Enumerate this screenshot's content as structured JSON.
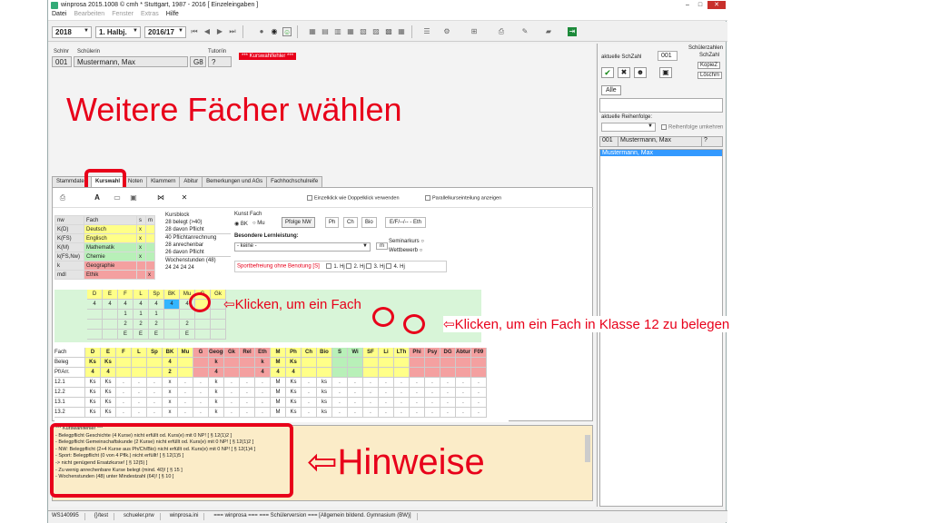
{
  "window": {
    "title": "winprosa 2015.1008 © cmh * Stuttgart, 1987 - 2016 [ Einzeleingaben ]"
  },
  "menu": [
    {
      "label": "Datei",
      "enabled": true
    },
    {
      "label": "Bearbeiten",
      "enabled": false
    },
    {
      "label": "Fenster",
      "enabled": false
    },
    {
      "label": "Extras",
      "enabled": false
    },
    {
      "label": "Hilfe",
      "enabled": true
    }
  ],
  "toolbar": {
    "year": "2018",
    "halbjahr": "1. Halbj.",
    "schuljahr": "2016/17"
  },
  "student": {
    "label_nr": "Schlnr",
    "label_name": "Schülerin",
    "label_tutor": "Tutor/in",
    "nr": "001",
    "name": "Mustermann, Max",
    "class": "G8",
    "tutor": "?",
    "error_flag": "*** Kurswahlfehler ***"
  },
  "overlay": {
    "title": "Weitere Fächer wählen",
    "callout1": "Klicken, um ein Fach",
    "callout2": "Klicken, um ein Fach in Klasse 12 zu belegen",
    "hints": "Hinweise"
  },
  "tabs": [
    "Stammdaten",
    "Kurswahl",
    "Noten",
    "Klammern",
    "Abitur",
    "Bemerkungen und AGs",
    "Fachhochschulreife"
  ],
  "tabs_active": 1,
  "options": {
    "einzelklick": "Einzelklick wie Doppelklick verwenden",
    "parallel": "Parallelkurseinteilung anzeigen"
  },
  "fach_table": {
    "headers": [
      "nw",
      "Fach",
      "s",
      "m"
    ],
    "rows": [
      [
        "K(D)",
        "Deutsch",
        "x",
        ""
      ],
      [
        "K(FS)",
        "Englisch",
        "x",
        ""
      ],
      [
        "K(M)",
        "Mathematik",
        "x",
        ""
      ],
      [
        "k(FS,Nw)",
        "Chemie",
        "x",
        ""
      ],
      [
        "k",
        "Geographie",
        "",
        ""
      ],
      [
        "mdl",
        "Ethik",
        "",
        "x"
      ]
    ]
  },
  "kursblock": {
    "title": "Kursblock",
    "l1": "28  belegt (>40)",
    "l2": "28  davon Pflicht",
    "l3": "40  Pflichtanrechnung",
    "l4": "28  anrechenbar",
    "l5": "26  davon Pflicht",
    "wochen": "Wochenstunden (48)",
    "wochen_vals": "24   24   24   24"
  },
  "kunst": {
    "title": "Kunst  Fach",
    "bk": "BK",
    "mu": "Mu",
    "pfolge": "Pfolge NW",
    "ph": "Ph",
    "ch": "Ch",
    "bio": "Bio",
    "efr": "E/F/--/-- - Eth",
    "besondere": "Besondere Lernleistung:",
    "keine": "- keine -",
    "m": "m",
    "seminar": "Seminarkurs",
    "wettbewerb": "Wettbewerb",
    "sport": "Sportbefreiung ohne Benotung [S]",
    "hj": [
      "1. Hj",
      "2. Hj",
      "3. Hj",
      "4. Hj"
    ]
  },
  "grid": {
    "top_headers": [
      "D",
      "E",
      "F",
      "L",
      "Sp",
      "BK",
      "Mu",
      "G",
      "Gk"
    ],
    "top_rows": [
      [
        "4",
        "4",
        "4",
        "4",
        "4",
        "4",
        "4",
        "",
        ""
      ],
      [
        "",
        "",
        "1",
        "1",
        "1",
        "",
        "",
        "",
        ""
      ],
      [
        "",
        "",
        "2",
        "2",
        "2",
        "",
        "2",
        "",
        ""
      ],
      [
        "",
        "",
        "E",
        "E",
        "E",
        "",
        "E",
        "",
        ""
      ]
    ],
    "row_labels": [
      "Fach",
      "Beleg",
      "Pf/Arr.",
      "12.1",
      "12.2",
      "13.1",
      "13.2"
    ],
    "columns": [
      "D",
      "E",
      "F",
      "L",
      "Sp",
      "BK",
      "Mu",
      "G",
      "Geogr",
      "Gk",
      "Rel",
      "Eth",
      "M",
      "Ph",
      "Ch",
      "Bio",
      "S",
      "Wi",
      "SF",
      "Li",
      "LTh",
      "Phi",
      "Psy",
      "DG",
      "Abtur",
      "F09"
    ],
    "beleg": [
      "Ks",
      "Ks",
      "",
      "",
      "",
      "4",
      "",
      "",
      "k",
      "",
      "",
      "k",
      "M",
      "Ks",
      "",
      "",
      "",
      "",
      "",
      "",
      "",
      "",
      "",
      "",
      "",
      ""
    ],
    "pfarr": [
      "4",
      "4",
      "",
      "",
      "",
      "2",
      "",
      "",
      "4",
      "",
      "",
      "4",
      "4",
      "4",
      "",
      "",
      "",
      "",
      "",
      "",
      "",
      "",
      "",
      "",
      "",
      ""
    ],
    "r121": [
      "Ks",
      "Ks",
      ".",
      ".",
      ".",
      "x",
      ".",
      ".",
      "k",
      ".",
      ".",
      ".",
      "M",
      "Ks",
      ".",
      "ks",
      ".",
      ".",
      ".",
      ".",
      ".",
      ".",
      ".",
      ".",
      ".",
      "."
    ],
    "r122": [
      "Ks",
      "Ks",
      ".",
      ".",
      ".",
      "x",
      ".",
      ".",
      "k",
      ".",
      ".",
      ".",
      "M",
      "Ks",
      ".",
      "ks",
      ".",
      ".",
      ".",
      ".",
      ".",
      ".",
      ".",
      ".",
      ".",
      "."
    ],
    "r131": [
      "Ks",
      "Ks",
      ".",
      ".",
      ".",
      "x",
      ".",
      ".",
      "k",
      ".",
      ".",
      ".",
      "M",
      "Ks",
      ".",
      "ks",
      ".",
      ".",
      ".",
      ".",
      ".",
      ".",
      ".",
      ".",
      ".",
      "."
    ],
    "r132": [
      "Ks",
      "Ks",
      ".",
      ".",
      ".",
      "x",
      ".",
      ".",
      "k",
      ".",
      ".",
      ".",
      "M",
      "Ks",
      ".",
      "ks",
      ".",
      ".",
      ".",
      ".",
      ".",
      ".",
      ".",
      ".",
      ".",
      "."
    ]
  },
  "hints": [
    "*** Kurswahlfehler ***",
    "- Belegpflicht Geschichte (4 Kurse) nicht erfüllt od. Kurs(e) mit 0 NP! [ § 12(1)2 ]",
    "- Belegpflicht Gemeinschaftskunde (2 Kurse) nicht erfüllt od. Kurs(e) mit 0 NP! [ § 12(1)2 ]",
    "- NW: Belegpflicht (2+4 Kurse aus Ph/Ch/Bio) nicht erfüllt od. Kurs(e) mit 0 NP! [ § 12(1)4 ]",
    "- Sport:  Belegpflicht (0 von 4 Pflk.) nicht erfüllt! [ § 12(1)5 ]",
    "  -> nicht genügend Ersatzkurse! [ § 12(5) ]",
    "- Zu wenig anrechenbare Kurse belegt (mind. 40)! [ § 15 ]",
    "- Wochenstunden (48) unter Mindestzahl (64)! [ § 10 ]"
  ],
  "right": {
    "title": "Schülerzahlen",
    "aktuell": "aktuelle SchZahl",
    "nr": "001",
    "label_schzahl": "SchZahl",
    "kopie": "KopieZ",
    "loschen": "Löschm",
    "alle": "Alle",
    "reihenfolge": "aktuelle Reihenfolge:",
    "umkehren": "Reihenfolge umkehren",
    "row_nr": "001",
    "row_name": "Mustermann, Max",
    "row_q": "?",
    "selected": "Mustermann, Max"
  },
  "status": [
    "WS140995",
    "{}/test",
    "schueler.prw",
    "winprosa.ini",
    "=== winprosa === === Schülerversion === [Allgemein bildend. Gymnasium (BW)]"
  ],
  "colors": {
    "accent_red": "#e8001a",
    "yellow": "#ffff88",
    "green": "#b8f0b8",
    "pink": "#f4a0a0",
    "hint_bg": "#fbecc8"
  }
}
